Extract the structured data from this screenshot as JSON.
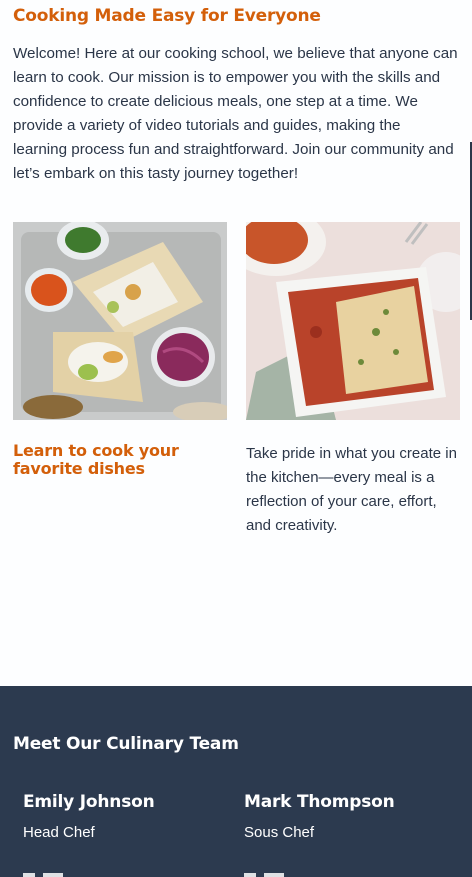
{
  "intro": {
    "heading": "Cooking Made Easy for Everyone",
    "text": "Welcome! Here at our cooking school, we believe that anyone can learn to cook. Our mission is to empower you with the skills and confidence to create delicious meals, one step at a time. We provide a variety of video tutorials and guides, making the learning process fun and straightforward. Join our community and let’s embark on this tasty journey together!"
  },
  "cards": [
    {
      "heading": "Learn to cook your favorite dishes"
    },
    {
      "text": "Take pride in what you create in the kitchen—every meal is a reflection of your care, effort, and creativity."
    }
  ],
  "team": {
    "title": "Meet Our Culinary Team",
    "members": [
      {
        "name": "Emily Johnson",
        "role": "Head Chef"
      },
      {
        "name": "Mark Thompson",
        "role": "Sous Chef"
      }
    ]
  },
  "colors": {
    "accent": "#d35f0a",
    "text": "#2b3648",
    "team_bg": "#2c3a4f"
  }
}
